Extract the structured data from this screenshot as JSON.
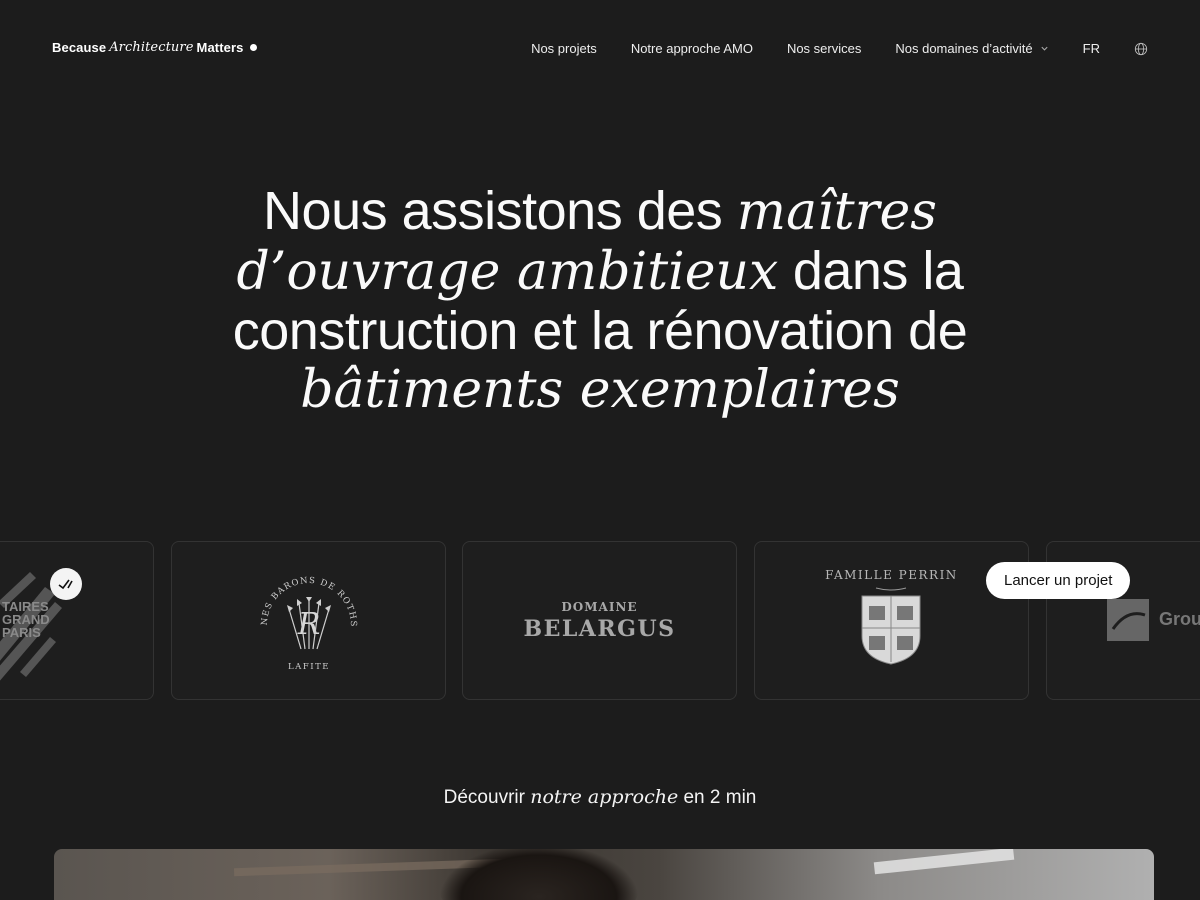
{
  "header": {
    "logo": {
      "part1": "Because",
      "part2": "Architecture",
      "part3": "Matters"
    },
    "nav": [
      {
        "label": "Nos projets"
      },
      {
        "label": "Notre approche AMO"
      },
      {
        "label": "Nos services"
      },
      {
        "label": "Nos domaines d’activité"
      },
      {
        "label": "FR"
      }
    ],
    "icons": {
      "dropdown": "chevron-down-icon",
      "language": "globe-icon"
    }
  },
  "hero": {
    "line1_a": "Nous assistons des ",
    "line1_b": "maîtres",
    "line2_a": "d’ouvrage ambitieux",
    "line2_b": " dans la",
    "line3": "construction et la rénovation de",
    "line4": "bâtiments exemplaires"
  },
  "clients": [
    {
      "name": "grand-paris-logo",
      "text": "TAIRES GRAND PARIS"
    },
    {
      "name": "domaines-barons-de-rothschild-logo",
      "text_top": "DOMAINES BARONS DE ROTHSCHILD",
      "text_bottom": "LAFITE",
      "monogram": "R"
    },
    {
      "name": "domaine-belargus-logo",
      "small": "DOMAINE",
      "big": "BELARGUS"
    },
    {
      "name": "famille-perrin-logo",
      "text": "FAMILLE PERRIN"
    },
    {
      "name": "groupe-logo",
      "text": "Grou"
    }
  ],
  "cta": {
    "label": "Lancer un projet"
  },
  "discover": {
    "a": "Découvrir ",
    "b": "notre approche",
    "c": " en 2 min"
  },
  "colors": {
    "background": "#1c1c1c",
    "text": "#f2f2f2",
    "cta_bg": "#ffffff",
    "card_border": "#333333"
  }
}
